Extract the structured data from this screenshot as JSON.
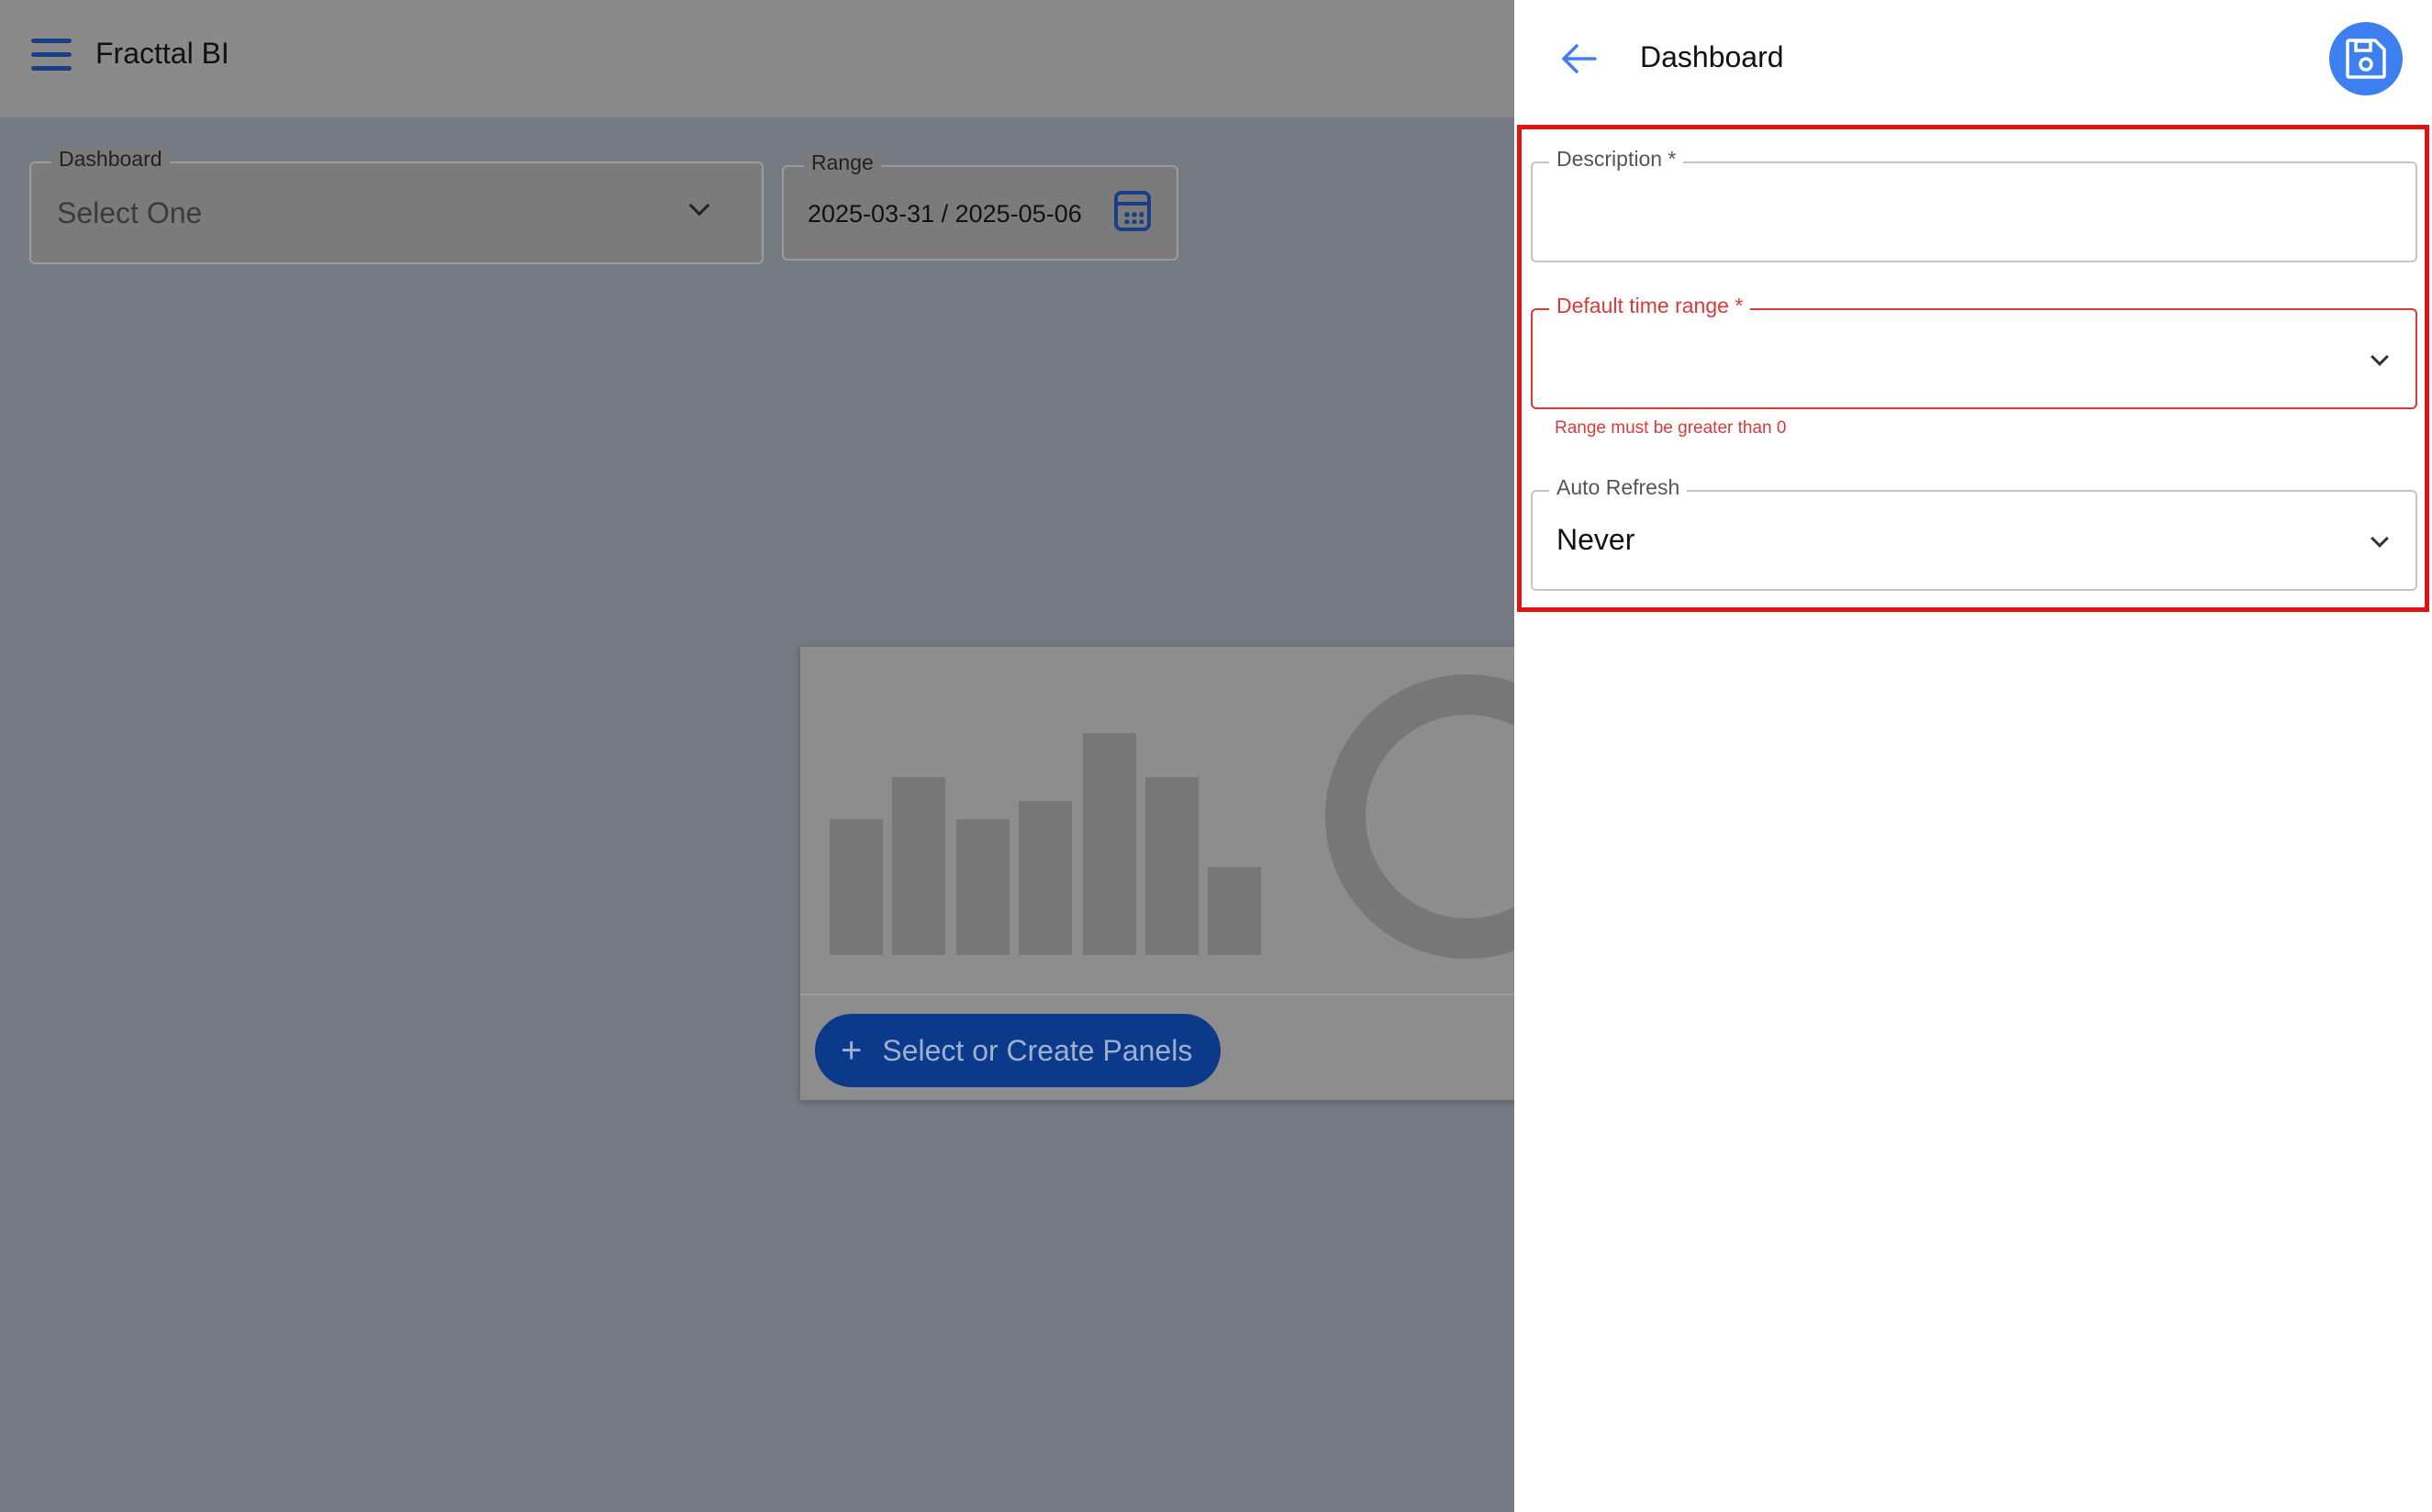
{
  "app": {
    "title": "Fracttal BI"
  },
  "filters": {
    "dashboard": {
      "label": "Dashboard",
      "value": "Select One"
    },
    "range": {
      "label": "Range",
      "value": "2025-03-31 / 2025-05-06"
    }
  },
  "panel": {
    "button_label": "Select or Create Panels"
  },
  "drawer": {
    "title": "Dashboard",
    "description": {
      "label": "Description *",
      "value": ""
    },
    "default_time_range": {
      "label": "Default time range *",
      "value": "",
      "error": "Range must be greater than 0"
    },
    "auto_refresh": {
      "label": "Auto Refresh",
      "value": "Never"
    }
  },
  "colors": {
    "accent": "#3d7ff0",
    "error": "#d83a3a",
    "highlight": "#e01212",
    "primary_dark": "#0c3a8a"
  }
}
